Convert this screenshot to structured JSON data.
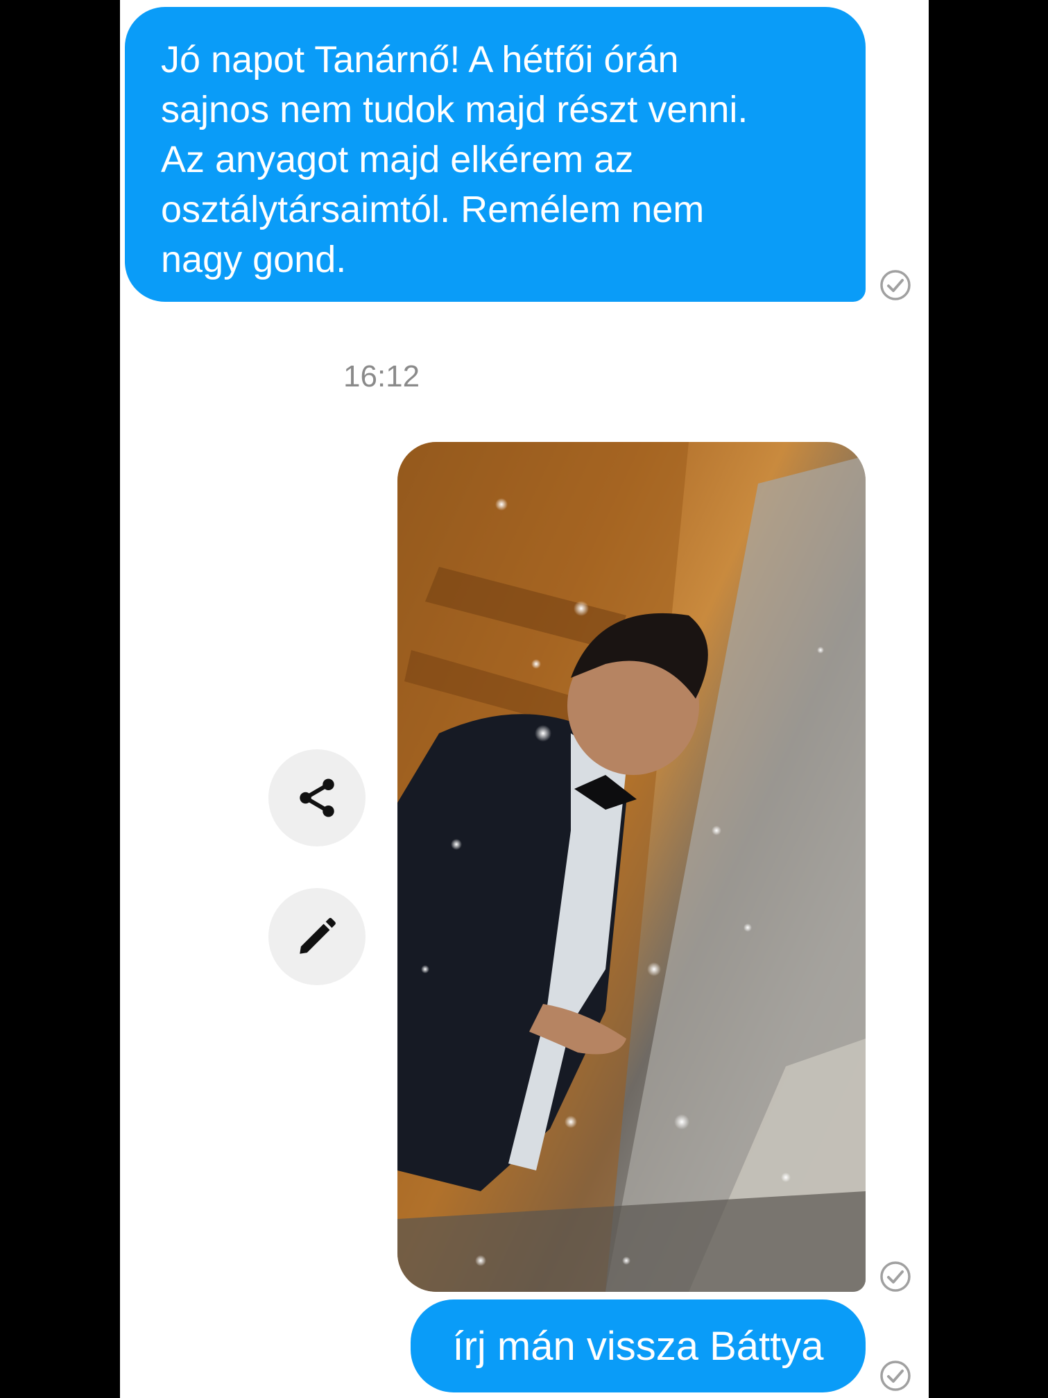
{
  "conversation": {
    "message_1": {
      "text": "Jó napot Tanárnő! A hétfői órán\nsajnos nem tudok majd részt venni.\nAz anyagot majd elkérem az\nosztálytársaimtól. Remélem nem\nnagy gond.",
      "status_icon": "sent-check-icon"
    },
    "timestamp": "16:12",
    "message_2": {
      "type": "photo",
      "status_icon": "sent-check-icon"
    },
    "photo_actions": {
      "share_icon": "share-icon",
      "edit_icon": "pencil-icon"
    },
    "message_3": {
      "text": "írj mán vissza Báttya",
      "status_icon": "sent-check-icon"
    }
  },
  "colors": {
    "bubble": "#0a9cf8",
    "background": "#ffffff",
    "frame": "#000000",
    "timestamp": "#8a8a8a",
    "action_button": "#efefef",
    "check": "#a0a0a0"
  }
}
